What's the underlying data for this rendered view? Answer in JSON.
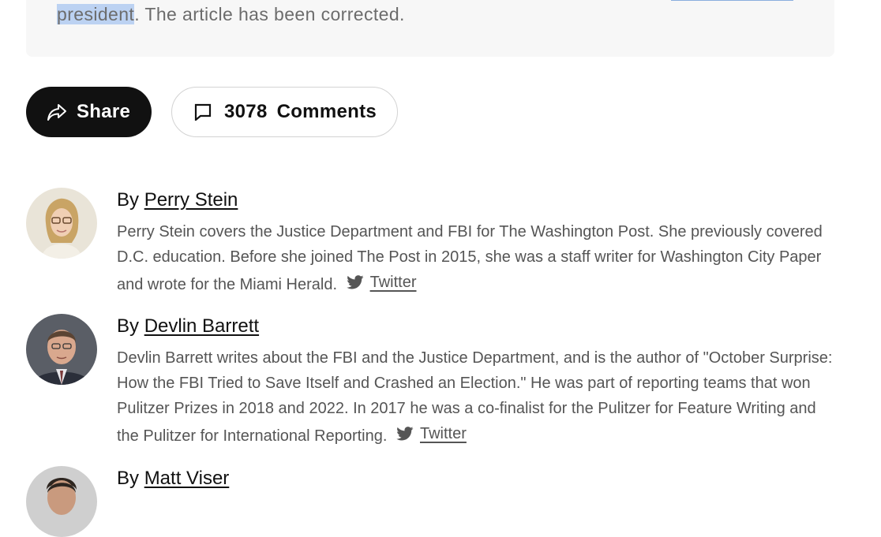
{
  "correction": {
    "highlighted": "president",
    "rest": ". The article has been corrected."
  },
  "actions": {
    "share_label": "Share",
    "comment_count": "3078",
    "comments_label": "Comments"
  },
  "authors": [
    {
      "by": "By",
      "name": "Perry Stein",
      "bio": "Perry Stein covers the Justice Department and FBI for The Washington Post. She previously covered D.C. education. Before she joined The Post in 2015, she was a staff writer for Washington City Paper and wrote for the Miami Herald.",
      "twitter": "Twitter"
    },
    {
      "by": "By",
      "name": "Devlin Barrett",
      "bio": "Devlin Barrett writes about the FBI and the Justice Department, and is the author of \"October Surprise: How the FBI Tried to Save Itself and Crashed an Election.\" He was part of reporting teams that won Pulitzer Prizes in 2018 and 2022. In 2017 he was a co-finalist for the Pulitzer for Feature Writing and the Pulitzer for International Reporting.",
      "twitter": "Twitter"
    },
    {
      "by": "By",
      "name": "Matt Viser"
    }
  ],
  "icons": {
    "share": "share-arrow-icon",
    "comments": "speech-bubble-icon",
    "twitter": "twitter-bird-icon"
  },
  "colors": {
    "share_bg": "#111111",
    "correction_bg": "#f7f7f7",
    "selection": "#bcd2f2",
    "bio_text": "#555555"
  }
}
